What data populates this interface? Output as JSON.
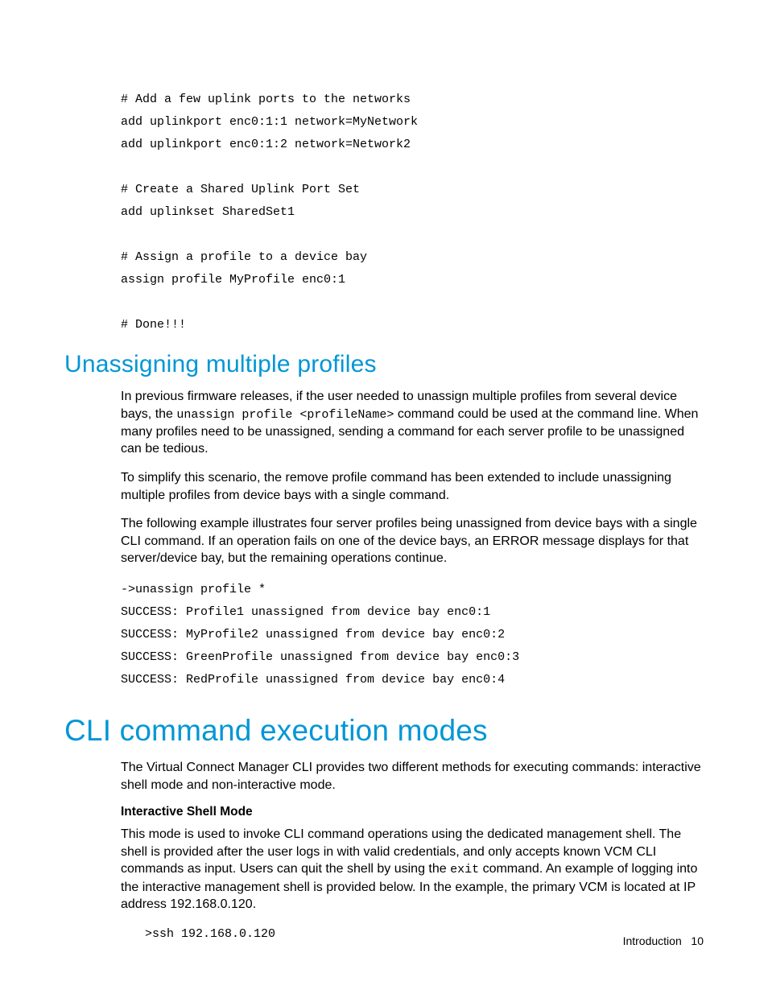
{
  "code_top": "# Add a few uplink ports to the networks\nadd uplinkport enc0:1:1 network=MyNetwork\nadd uplinkport enc0:1:2 network=Network2\n\n# Create a Shared Uplink Port Set\nadd uplinkset SharedSet1\n\n# Assign a profile to a device bay\nassign profile MyProfile enc0:1\n\n# Done!!!",
  "h2_unassign": "Unassigning multiple profiles",
  "p1_pre": "In previous firmware releases, if the user needed to unassign multiple profiles from several device bays, the ",
  "p1_code": "unassign profile <profileName>",
  "p1_post": " command could be used at the command line. When many profiles need to be unassigned, sending a command for each server profile to be unassigned can be tedious.",
  "p2": "To simplify this scenario, the remove profile command has been extended to include unassigning multiple profiles from device bays with a single command.",
  "p3": "The following example illustrates four server profiles being unassigned from device bays with a single CLI command. If an operation fails on one of the device bays, an ERROR message displays for that server/device bay, but the remaining operations continue.",
  "code_unassign": "->unassign profile *\nSUCCESS: Profile1 unassigned from device bay enc0:1\nSUCCESS: MyProfile2 unassigned from device bay enc0:2\nSUCCESS: GreenProfile unassigned from device bay enc0:3\nSUCCESS: RedProfile unassigned from device bay enc0:4",
  "h1_cli": "CLI command execution modes",
  "p4": "The Virtual Connect Manager CLI provides two different methods for executing commands: interactive shell mode and non-interactive mode.",
  "subhead_interactive": "Interactive Shell Mode",
  "p5_pre": "This mode is used to invoke CLI command operations using the dedicated management shell. The shell is provided after the user logs in with valid credentials, and only accepts known VCM CLI commands as input. Users can quit the shell by using the ",
  "p5_code": "exit",
  "p5_post": " command. An example of logging into the interactive management shell is provided below. In the example, the primary VCM is located at IP address 192.168.0.120.",
  "code_ssh": ">ssh 192.168.0.120",
  "footer_section": "Introduction",
  "footer_page": "10"
}
